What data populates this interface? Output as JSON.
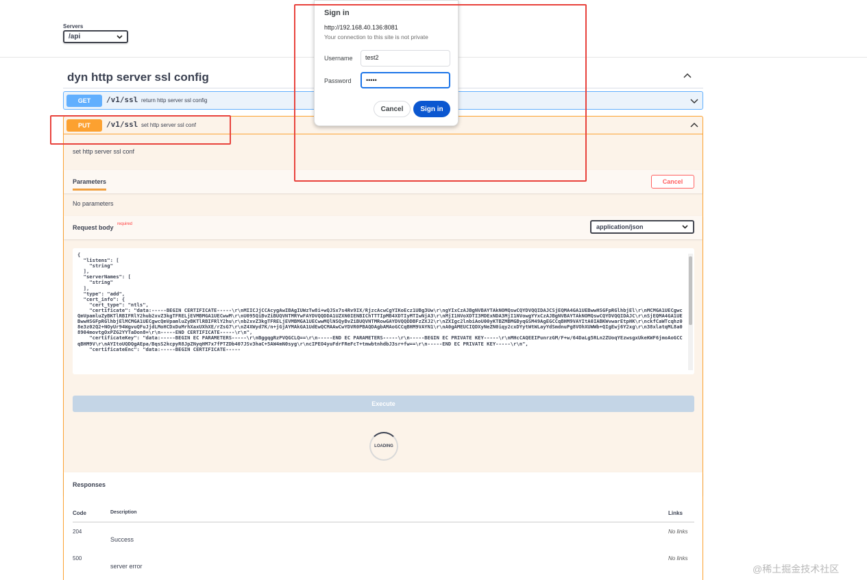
{
  "servers": {
    "label": "Servers",
    "selected": "/api"
  },
  "section": {
    "title": "dyn http server ssl config"
  },
  "get_op": {
    "method": "GET",
    "path": "/v1/ssl",
    "summary": "return http server ssl config"
  },
  "put_op": {
    "method": "PUT",
    "path": "/v1/ssl",
    "summary": "set http server ssl conf",
    "description": "set http server ssl conf",
    "parameters_tab": "Parameters",
    "cancel_label": "Cancel",
    "no_parameters": "No parameters",
    "request_body_label": "Request body",
    "required_label": "required",
    "content_type": "application/json",
    "body_text": "{\n  \"listens\": [\n    \"string\"\n  ],\n  \"serverNames\": [\n    \"string\"\n  ],\n  \"type\": \"add\",\n  \"cert_info\": {\n    \"cert_type\": \"ntls\",\n    \"certificate\": \"data:-----BEGIN CERTIFICATE-----\\r\\nMIICJjCCAcygAwIBAgIUWzTw8i+wQJSx7s4Rv9IX/RjzcAcwCgYIKoEcz1UBg3Uw\\r\\ngYIxCzAJBgNVBAYTAkNOMQswCQYDVQQIDAJCSjEQMA4GA1UEBwwHSGFpRGlhbjEl\\r\\nMCMGA1UECgwcQmVpamluZyBKTlRBIFRlY2hub2xvZ3kgTFRELjEVMBMGA1UECwwM\\r\\nU095QiBvZiBUQVNTMRYwFAYDVQQDDA1UZXN0IENBIChTTTIpMB4XDTIyMTIwNjA3\\r\\nMjI1NVoXDTI3MDExNDA3MjI1NVowgYYxCzAJBgNVBAYTAkNOMQswCQYDVQQIDAJC\\r\\nSjEQMA4GA1UEBwwHSGFpRGlhbjElMCMGA1UECgwcQmVpamluZyBKTlRBIFRlY2hu\\r\\nb2xvZ3kgTFRELjEVMBMGA1UECwwMQlNSQyBvZiBUQVNTMRowGAYDVQQDDBFzZXJ2\\r\\nZXIgc2lnbiAoU00yKTBZMBMGByqGSM49AgEGCCqBHM9VAYItA0IABKWvwarEtpHK\\r\\nckfCaWTcqhz08e3z02Q2+NOyUr94WgvuQFuJjdLMoHCDxDuMrhXaxUXhXE/rZsG7\\r\\nZ4XWyd7K/n+jGjAYMAkGA1UdEwQCMAAwCwYDVR0PBAQDAgbAMAoGCCqBHM9VAYN1\\r\\nA0gAMEUCIQDXyNeZN0iqy2cxDYytWtWLayYdSmdnuPg8VOhXUWWb+QIgEwj6Y2xg\\r\\n38xlatqML8a08904movtgOxPZG2YYTaDon8=\\r\\n-----END CERTIFICATE-----\\r\\n\",\n    \"certificateKey\": \"data:-----BEGIN EC PARAMETERS-----\\r\\nBggqgRzPVQGCLQ==\\r\\n-----END EC PARAMETERS-----\\r\\n-----BEGIN EC PRIVATE KEY-----\\r\\nMHcCAQEEIPunrzGM/F+w/64DaLg5RLn2ZUoqYEzwsgxUkeKWF6jmoAoGCCqBHM9V\\r\\nAYItoUQDQgAEpa/BqsS2kcpyR8JpZNyqHM7x7fPTZDb407JSv3haC+5AW4mN0syg\\r\\ncIPEO4yuFdrFReFcT+tmwbtnhdbJ3sr+fw==\\r\\n-----END EC PRIVATE KEY-----\\r\\n\",\n    \"certificateEnc\": \"data:-----BEGIN CERTIFICATE-----",
    "execute_label": "Execute",
    "loading_label": "LOADING",
    "responses_label": "Responses",
    "table_headers": {
      "code": "Code",
      "description": "Description",
      "links": "Links"
    },
    "responses": [
      {
        "code": "204",
        "description": "Success",
        "links": "No links"
      },
      {
        "code": "500",
        "description": "server error",
        "links": "No links"
      }
    ]
  },
  "dialog": {
    "title": "Sign in",
    "url": "http://192.168.40.136:8081",
    "warning": "Your connection to this site is not private",
    "username_label": "Username",
    "username_value": "test2",
    "password_label": "Password",
    "password_value": "•••••",
    "cancel_label": "Cancel",
    "signin_label": "Sign in"
  },
  "watermark": "@稀土掘金技术社区",
  "colors": {
    "get": "#61affe",
    "put": "#fca130",
    "annotation": "#e8413b",
    "primary": "#0b57d0"
  }
}
